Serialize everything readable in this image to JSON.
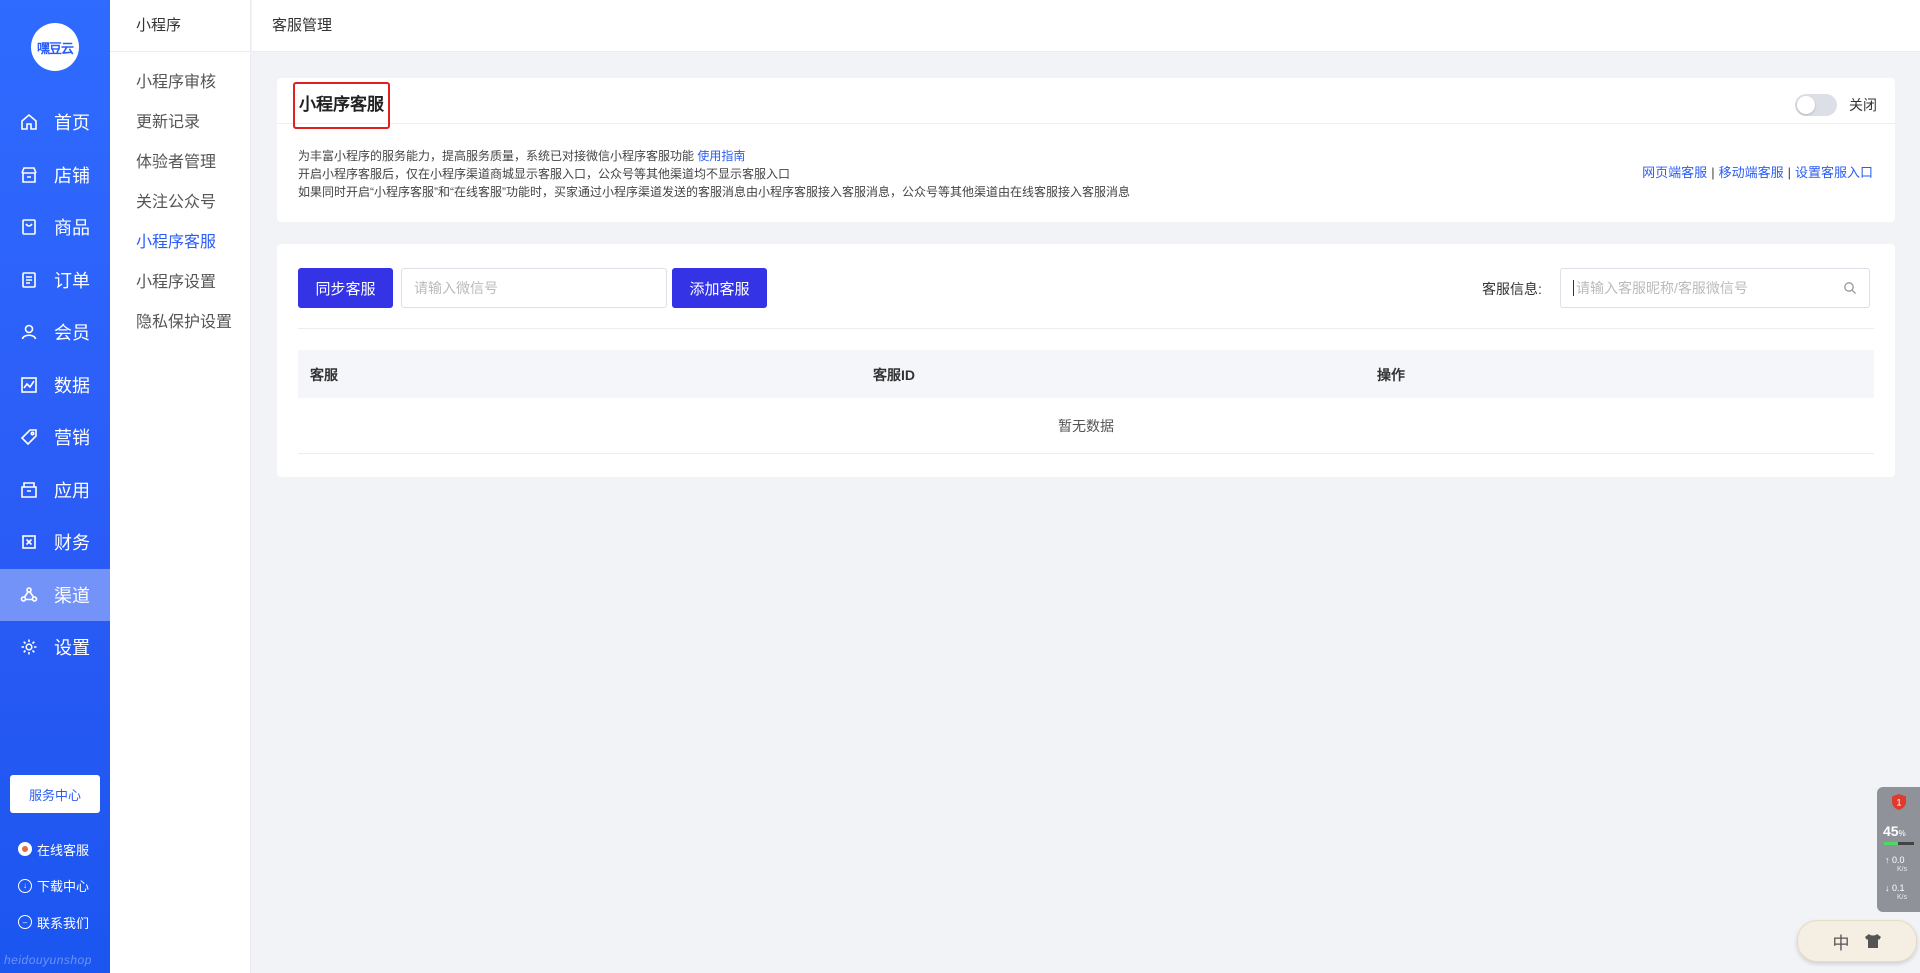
{
  "brand": {
    "logo_text": "嘿豆云",
    "watermark": "heidouyunshop"
  },
  "primary_nav": [
    {
      "label": "首页",
      "icon": "home-icon"
    },
    {
      "label": "店铺",
      "icon": "store-icon"
    },
    {
      "label": "商品",
      "icon": "product-icon"
    },
    {
      "label": "订单",
      "icon": "order-icon"
    },
    {
      "label": "会员",
      "icon": "member-icon"
    },
    {
      "label": "数据",
      "icon": "chart-icon"
    },
    {
      "label": "营销",
      "icon": "tag-icon"
    },
    {
      "label": "应用",
      "icon": "app-icon"
    },
    {
      "label": "财务",
      "icon": "finance-icon"
    },
    {
      "label": "渠道",
      "icon": "channel-icon",
      "active": true
    },
    {
      "label": "设置",
      "icon": "gear-icon"
    }
  ],
  "service_center": {
    "label": "服务中心"
  },
  "bottom_links": [
    {
      "label": "在线客服",
      "icon": "avatar-icon"
    },
    {
      "label": "下载中心",
      "icon": "download-icon"
    },
    {
      "label": "联系我们",
      "icon": "contact-icon"
    }
  ],
  "secondary_nav": {
    "title": "小程序",
    "items": [
      {
        "label": "小程序审核"
      },
      {
        "label": "更新记录"
      },
      {
        "label": "体验者管理"
      },
      {
        "label": "关注公众号"
      },
      {
        "label": "小程序客服",
        "active": true
      },
      {
        "label": "小程序设置"
      },
      {
        "label": "隐私保护设置"
      }
    ]
  },
  "breadcrumb": "客服管理",
  "service_panel": {
    "title": "小程序客服",
    "toggle_label": "关闭",
    "toggle_on": false,
    "desc_line1": "为丰富小程序的服务能力，提高服务质量，系统已对接微信小程序客服功能",
    "guide_link": "使用指南",
    "desc_line2": "开启小程序客服后，仅在小程序渠道商城显示客服入口，公众号等其他渠道均不显示客服入口",
    "desc_line3": "如果同时开启“小程序客服”和“在线客服”功能时，买家通过小程序渠道发送的客服消息由小程序客服接入客服消息，公众号等其他渠道由在线客服接入客服消息",
    "links": [
      "网页端客服",
      "移动端客服",
      "设置客服入口"
    ],
    "link_separator": "|"
  },
  "list_panel": {
    "sync_button": "同步客服",
    "wechat_placeholder": "请输入微信号",
    "add_button": "添加客服",
    "filter_label": "客服信息:",
    "search_placeholder": "请输入客服昵称/客服微信号",
    "columns": [
      "客服",
      "客服ID",
      "操作"
    ],
    "empty_text": "暂无数据"
  },
  "system_widget": {
    "badge": "1",
    "cpu_value": "45",
    "cpu_unit": "%",
    "cpu_fraction": 0.45,
    "upload": "0.0",
    "download": "0.1",
    "speed_unit": "K/s"
  },
  "ime": {
    "mode": "中"
  }
}
